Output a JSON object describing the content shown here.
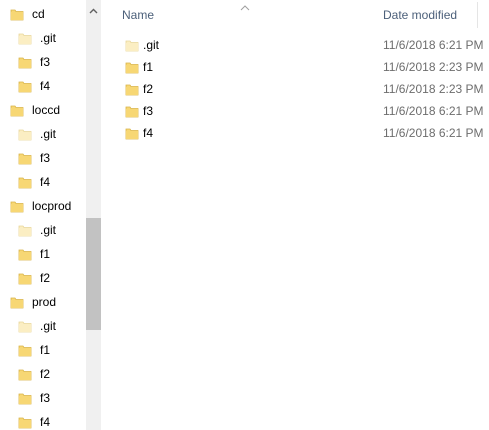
{
  "nav_tree": [
    {
      "label": "cd",
      "level": 0,
      "icon": "folder-icon"
    },
    {
      "label": ".git",
      "level": 1,
      "icon": "folder-hidden-icon"
    },
    {
      "label": "f3",
      "level": 1,
      "icon": "folder-icon"
    },
    {
      "label": "f4",
      "level": 1,
      "icon": "folder-icon"
    },
    {
      "label": "loccd",
      "level": 0,
      "icon": "folder-icon"
    },
    {
      "label": ".git",
      "level": 1,
      "icon": "folder-hidden-icon"
    },
    {
      "label": "f3",
      "level": 1,
      "icon": "folder-icon"
    },
    {
      "label": "f4",
      "level": 1,
      "icon": "folder-icon"
    },
    {
      "label": "locprod",
      "level": 0,
      "icon": "folder-icon"
    },
    {
      "label": ".git",
      "level": 1,
      "icon": "folder-hidden-icon"
    },
    {
      "label": "f1",
      "level": 1,
      "icon": "folder-icon"
    },
    {
      "label": "f2",
      "level": 1,
      "icon": "folder-icon"
    },
    {
      "label": "prod",
      "level": 0,
      "icon": "folder-icon"
    },
    {
      "label": ".git",
      "level": 1,
      "icon": "folder-hidden-icon"
    },
    {
      "label": "f1",
      "level": 1,
      "icon": "folder-icon"
    },
    {
      "label": "f2",
      "level": 1,
      "icon": "folder-icon"
    },
    {
      "label": "f3",
      "level": 1,
      "icon": "folder-icon"
    },
    {
      "label": "f4",
      "level": 1,
      "icon": "folder-icon"
    }
  ],
  "columns": {
    "name": "Name",
    "date_modified": "Date modified",
    "sort_indicator": "ascending"
  },
  "files": [
    {
      "name": ".git",
      "date": "11/6/2018 6:21 PM",
      "icon": "folder-hidden-icon"
    },
    {
      "name": "f1",
      "date": "11/6/2018 2:23 PM",
      "icon": "folder-icon"
    },
    {
      "name": "f2",
      "date": "11/6/2018 2:23 PM",
      "icon": "folder-icon"
    },
    {
      "name": "f3",
      "date": "11/6/2018 6:21 PM",
      "icon": "folder-icon"
    },
    {
      "name": "f4",
      "date": "11/6/2018 6:21 PM",
      "icon": "folder-icon"
    }
  ],
  "colors": {
    "folder": "#f7d774",
    "folder_hidden": "#fbeec3",
    "header_text": "#4c607a",
    "date_text": "#6d6d6d",
    "scrollbar_track": "#f0f0f0",
    "scrollbar_thumb": "#c2c2c2"
  }
}
